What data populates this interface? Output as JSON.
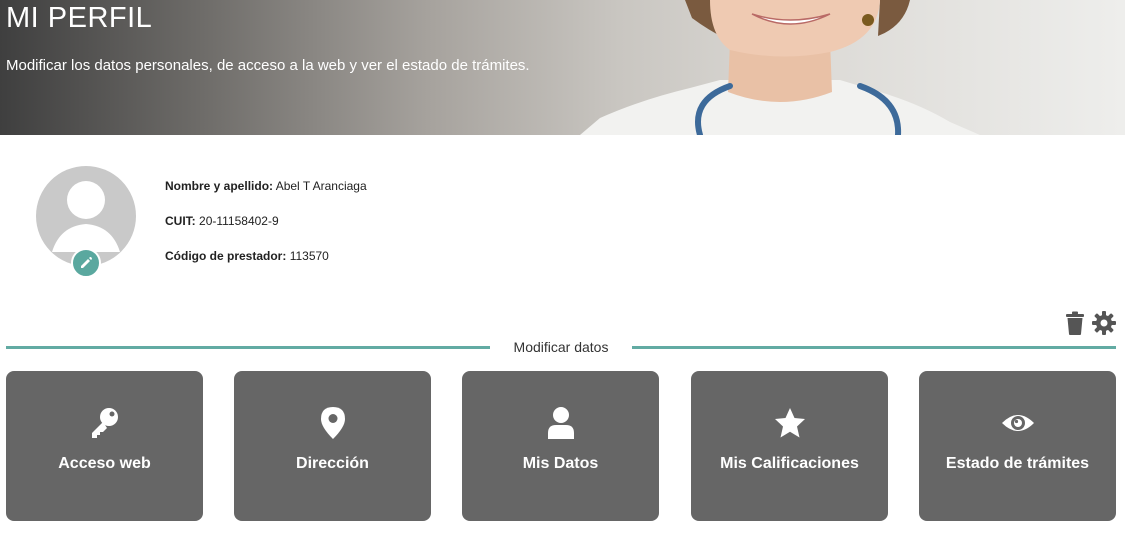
{
  "banner": {
    "title": "MI PERFIL",
    "subtitle": "Modificar los datos personales, de acceso a la web y ver el estado de trámites."
  },
  "profile": {
    "name_label": "Nombre y apellido:",
    "name_value": "Abel T Aranciaga",
    "cuit_label": "CUIT:",
    "cuit_value": "20-11158402-9",
    "code_label": "Código de prestador:",
    "code_value": "113570"
  },
  "section": {
    "title": "Modificar datos"
  },
  "cards": [
    {
      "label": "Acceso web",
      "icon": "key-icon"
    },
    {
      "label": "Dirección",
      "icon": "map-pin-icon"
    },
    {
      "label": "Mis Datos",
      "icon": "user-icon"
    },
    {
      "label": "Mis Calificaciones",
      "icon": "star-icon"
    },
    {
      "label": "Estado de trámites",
      "icon": "eye-icon"
    }
  ],
  "colors": {
    "accent": "#5aa89f",
    "card_bg": "#666666",
    "divider": "#62aba3"
  }
}
